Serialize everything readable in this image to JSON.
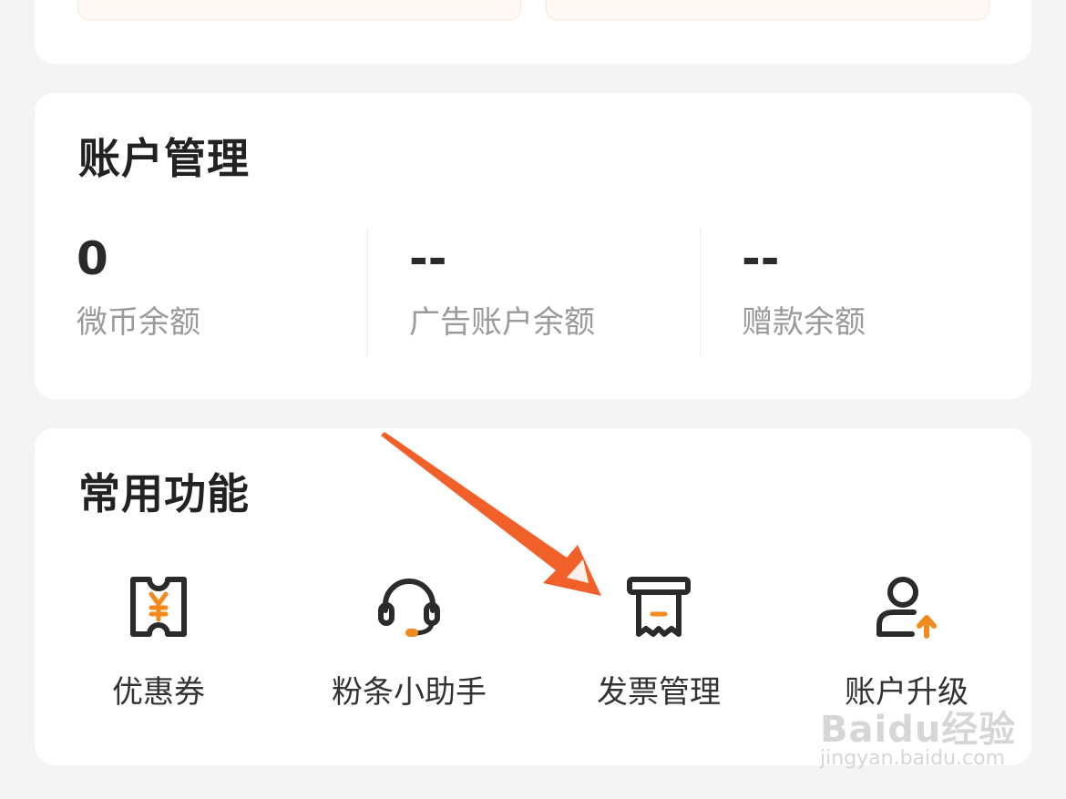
{
  "account": {
    "title": "账户管理",
    "stats": [
      {
        "value": "0",
        "label": "微币余额"
      },
      {
        "value": "--",
        "label": "广告账户余额"
      },
      {
        "value": "--",
        "label": "赠款余额"
      }
    ]
  },
  "functions": {
    "title": "常用功能",
    "items": [
      {
        "label": "优惠券",
        "icon": "coupon-icon"
      },
      {
        "label": "粉条小助手",
        "icon": "headset-icon"
      },
      {
        "label": "发票管理",
        "icon": "invoice-icon"
      },
      {
        "label": "账户升级",
        "icon": "user-upgrade-icon"
      }
    ]
  },
  "annotation": {
    "icon": "pointer-arrow-icon",
    "color": "#f2602a"
  },
  "watermark": {
    "brand": "Baidu经验",
    "url": "jingyan.baidu.com"
  },
  "colors": {
    "accent": "#f28a1e",
    "icon": "#2b2b2b",
    "muted": "#9a9a9a"
  }
}
